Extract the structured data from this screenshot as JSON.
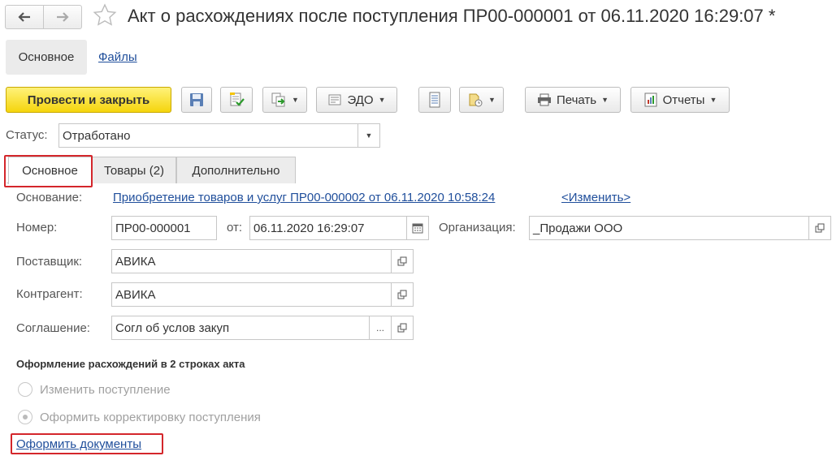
{
  "window": {
    "title": "Акт о расхождениях после поступления ПР00-000001 от 06.11.2020 16:29:07 *"
  },
  "sections": {
    "main_label": "Основное",
    "files_label": "Файлы"
  },
  "toolbar": {
    "post_close_label": "Провести и закрыть",
    "edo_label": "ЭДО",
    "print_label": "Печать",
    "reports_label": "Отчеты"
  },
  "status": {
    "label": "Статус:",
    "value": "Отработано"
  },
  "tabs": [
    {
      "label": "Основное"
    },
    {
      "label": "Товары (2)"
    },
    {
      "label": "Дополнительно"
    }
  ],
  "form": {
    "basis_label": "Основание:",
    "basis_link": "Приобретение товаров и услуг ПР00-000002 от 06.11.2020 10:58:24",
    "change_link": "<Изменить>",
    "number_label": "Номер:",
    "number_value": "ПР00-000001",
    "date_label": "от:",
    "date_value": "06.11.2020 16:29:07",
    "org_label": "Организация:",
    "org_value": "_Продажи ООО",
    "supplier_label": "Поставщик:",
    "supplier_value": "АВИКА",
    "counterparty_label": "Контрагент:",
    "counterparty_value": "АВИКА",
    "agreement_label": "Соглашение:",
    "agreement_value": "Согл об услов закуп",
    "ellipsis": "..."
  },
  "discrepancy": {
    "title": "Оформление расхождений в 2 строках акта",
    "option_change": "Изменить поступление",
    "option_correction": "Оформить корректировку поступления",
    "selected": "option_correction",
    "action_link": "Оформить документы"
  },
  "colors": {
    "primary_button": "#f5d50d",
    "link": "#1f4e9b",
    "highlight_box": "#d4262b"
  },
  "icons": {
    "back": "arrow-left-icon",
    "forward": "arrow-right-icon",
    "favorite": "star-icon",
    "save": "floppy-disk-icon",
    "post": "post-document-icon",
    "create_based": "create-based-on-icon",
    "edo": "edo-icon",
    "list": "list-icon",
    "attach": "attachment-icon",
    "print": "printer-icon",
    "reports": "reports-icon",
    "calendar": "calendar-icon",
    "open": "open-form-icon"
  }
}
